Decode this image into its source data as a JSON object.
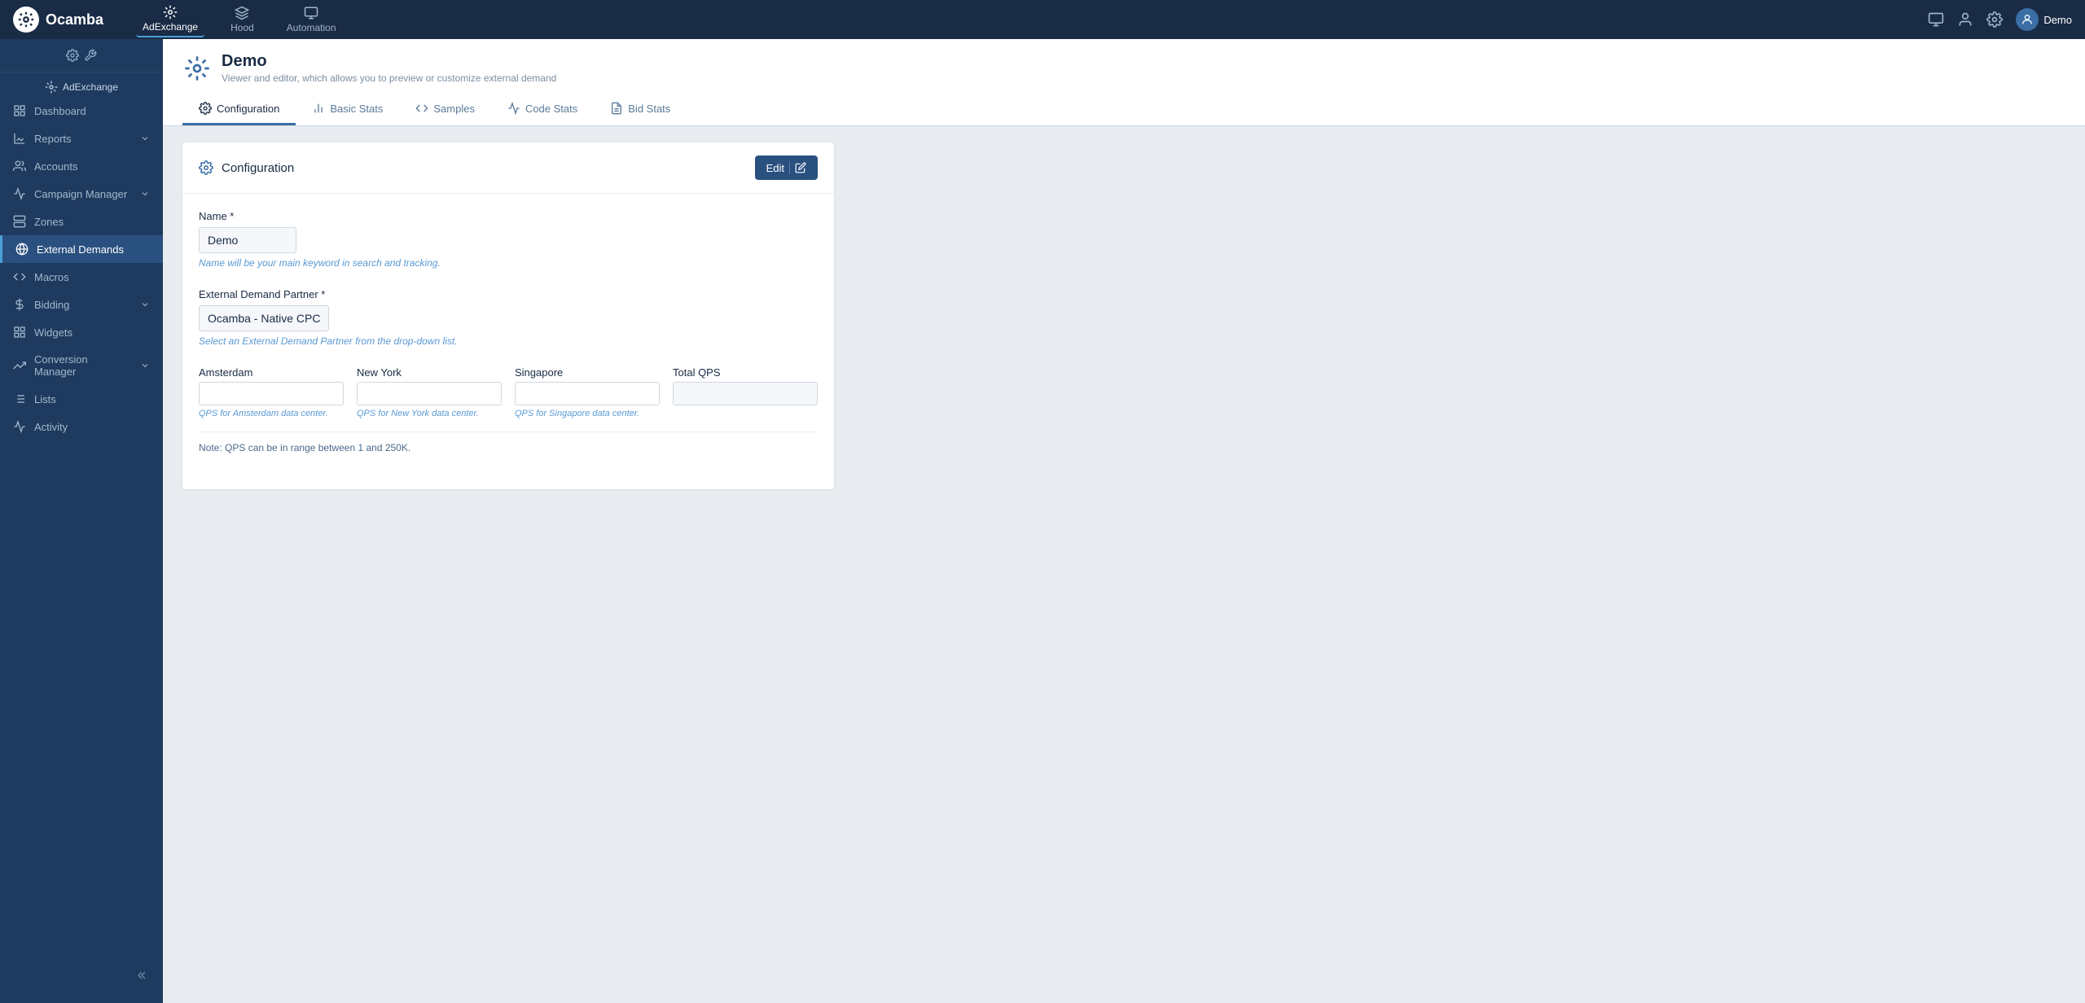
{
  "app": {
    "name": "Ocamba"
  },
  "top_nav": {
    "items": [
      {
        "id": "adexchange",
        "label": "AdExchange",
        "active": true
      },
      {
        "id": "hood",
        "label": "Hood",
        "active": false
      },
      {
        "id": "automation",
        "label": "Automation",
        "active": false
      }
    ],
    "user": "Demo"
  },
  "sidebar": {
    "section_label": "AdExchange",
    "items": [
      {
        "id": "dashboard",
        "label": "Dashboard",
        "has_chevron": false
      },
      {
        "id": "reports",
        "label": "Reports",
        "has_chevron": true
      },
      {
        "id": "accounts",
        "label": "Accounts",
        "has_chevron": false
      },
      {
        "id": "campaign_manager",
        "label": "Campaign Manager",
        "has_chevron": true
      },
      {
        "id": "zones",
        "label": "Zones",
        "has_chevron": false
      },
      {
        "id": "external_demands",
        "label": "External Demands",
        "has_chevron": false,
        "active": true
      },
      {
        "id": "macros",
        "label": "Macros",
        "has_chevron": false
      },
      {
        "id": "bidding",
        "label": "Bidding",
        "has_chevron": true
      },
      {
        "id": "widgets",
        "label": "Widgets",
        "has_chevron": false
      },
      {
        "id": "conversion_manager",
        "label": "Conversion Manager",
        "has_chevron": true
      },
      {
        "id": "lists",
        "label": "Lists",
        "has_chevron": false
      },
      {
        "id": "activity",
        "label": "Activity",
        "has_chevron": false
      }
    ]
  },
  "page": {
    "title": "Demo",
    "description": "Viewer and editor, which allows you to preview or customize external demand"
  },
  "tabs": [
    {
      "id": "configuration",
      "label": "Configuration",
      "active": true
    },
    {
      "id": "basic_stats",
      "label": "Basic Stats",
      "active": false
    },
    {
      "id": "samples",
      "label": "Samples",
      "active": false
    },
    {
      "id": "code_stats",
      "label": "Code Stats",
      "active": false
    },
    {
      "id": "bid_stats",
      "label": "Bid Stats",
      "active": false
    }
  ],
  "configuration": {
    "title": "Configuration",
    "edit_label": "Edit",
    "name_label": "Name *",
    "name_value": "Demo",
    "name_hint": "Name will be your main keyword in search and tracking.",
    "partner_label": "External Demand Partner *",
    "partner_value": "Ocamba - Native CPC",
    "partner_hint": "Select an External Demand Partner from the drop-down list.",
    "qps": {
      "amsterdam_label": "Amsterdam",
      "amsterdam_hint": "QPS for Amsterdam data center.",
      "newyork_label": "New York",
      "newyork_hint": "QPS for New York data center.",
      "singapore_label": "Singapore",
      "singapore_hint": "QPS for Singapore data center.",
      "total_label": "Total QPS",
      "note": "Note: QPS can be in range between 1 and 250K."
    }
  }
}
